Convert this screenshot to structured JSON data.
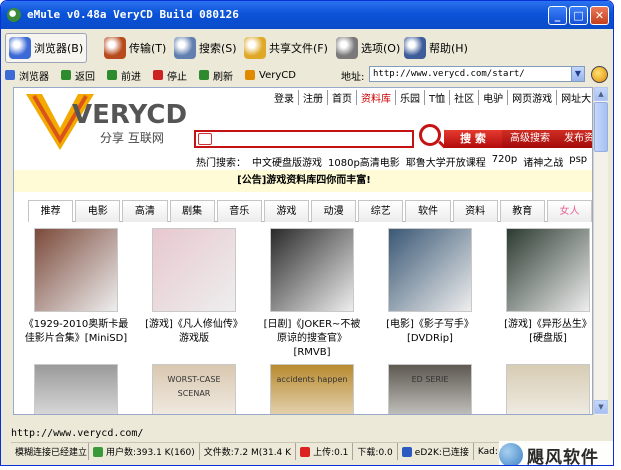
{
  "window": {
    "title": "eMule v0.48a VeryCD Build 080126",
    "min": "_",
    "max": "□",
    "close": "✕"
  },
  "toolbar": [
    {
      "label": "浏览器(B)",
      "color": "#3d6ad6"
    },
    {
      "label": "传输(T)",
      "color": "#b84b1d"
    },
    {
      "label": "搜索(S)",
      "color": "#6180b0"
    },
    {
      "label": "共享文件(F)",
      "color": "#e0a828"
    },
    {
      "label": "选项(O)",
      "color": "#7a7a7a"
    },
    {
      "label": "帮助(H)",
      "color": "#3e5c9a"
    }
  ],
  "nav": [
    {
      "label": "浏览器",
      "color": "#3d6ad6"
    },
    {
      "label": "返回",
      "color": "#2d8a2d"
    },
    {
      "label": "前进",
      "color": "#2d8a2d"
    },
    {
      "label": "停止",
      "color": "#c22"
    },
    {
      "label": "刷新",
      "color": "#2d8a2d"
    },
    {
      "label": "VeryCD",
      "color": "#e08a00"
    }
  ],
  "address": {
    "label": "地址:",
    "value": "http://www.verycd.com/start/"
  },
  "page": {
    "logo_text": "ERYCD",
    "logo_slogan": "分享 互联网",
    "toplinks": [
      "登录",
      "注册",
      "首页",
      "资料库",
      "乐园",
      "T恤",
      "社区",
      "电驴",
      "网页游戏",
      "网址大"
    ],
    "search_button": "搜 索",
    "adv_search": "高级搜索",
    "publish": "发布资源",
    "hot_label": "热门搜索：",
    "hot_terms": [
      "中文硬盘版游戏",
      "1080p高清电影",
      "耶鲁大学开放课程",
      "720p",
      "诸神之战",
      "psp"
    ],
    "notice": "[公告]游戏资料库四你而丰富!",
    "tabs": [
      "推荐",
      "电影",
      "高清",
      "剧集",
      "音乐",
      "游戏",
      "动漫",
      "综艺",
      "软件",
      "资料",
      "教育",
      "女人"
    ],
    "items": [
      {
        "cap": "《1929-2010奥斯卡最",
        "cap2": "佳影片合集》[MiniSD]",
        "cap3": "",
        "thumb": "#7b4a3a"
      },
      {
        "cap": "[游戏]《凡人修仙传》",
        "cap2": "游戏版",
        "cap3": "",
        "thumb": "#e7c8cf"
      },
      {
        "cap": "[日剧]《JOKER~不被",
        "cap2": "原谅的搜查官》",
        "cap3": "[RMVB]",
        "thumb": "#2a2a2a"
      },
      {
        "cap": "[电影]《影子写手》",
        "cap2": "[DVDRip]",
        "cap3": "",
        "thumb": "#3a5875"
      },
      {
        "cap": "[游戏]《异形丛生》",
        "cap2": "[硬盘版]",
        "cap3": "",
        "thumb": "#2b3a30"
      }
    ],
    "items_row2": [
      {
        "thumb": "#9a9a9a"
      },
      {
        "thumb": "#d9c8b0",
        "text": "WORST-CASE SCENAR"
      },
      {
        "thumb": "#b88a30",
        "text": "accidents happen"
      },
      {
        "thumb": "#5e5a52",
        "text": "ED SERIE"
      },
      {
        "thumb": "#d7ccb4"
      }
    ]
  },
  "status": {
    "url": "http://www.verycd.com/",
    "connect": "模糊连接已经建立",
    "users": "用户数:393.1 K(160)",
    "files": "文件数:7.2 M(31.4 K",
    "upload": "上传:0.1",
    "download": "下载:0.0",
    "ed2k": "eD2K:已连接",
    "kad": "Kad:"
  },
  "watermark": "飓风软件"
}
